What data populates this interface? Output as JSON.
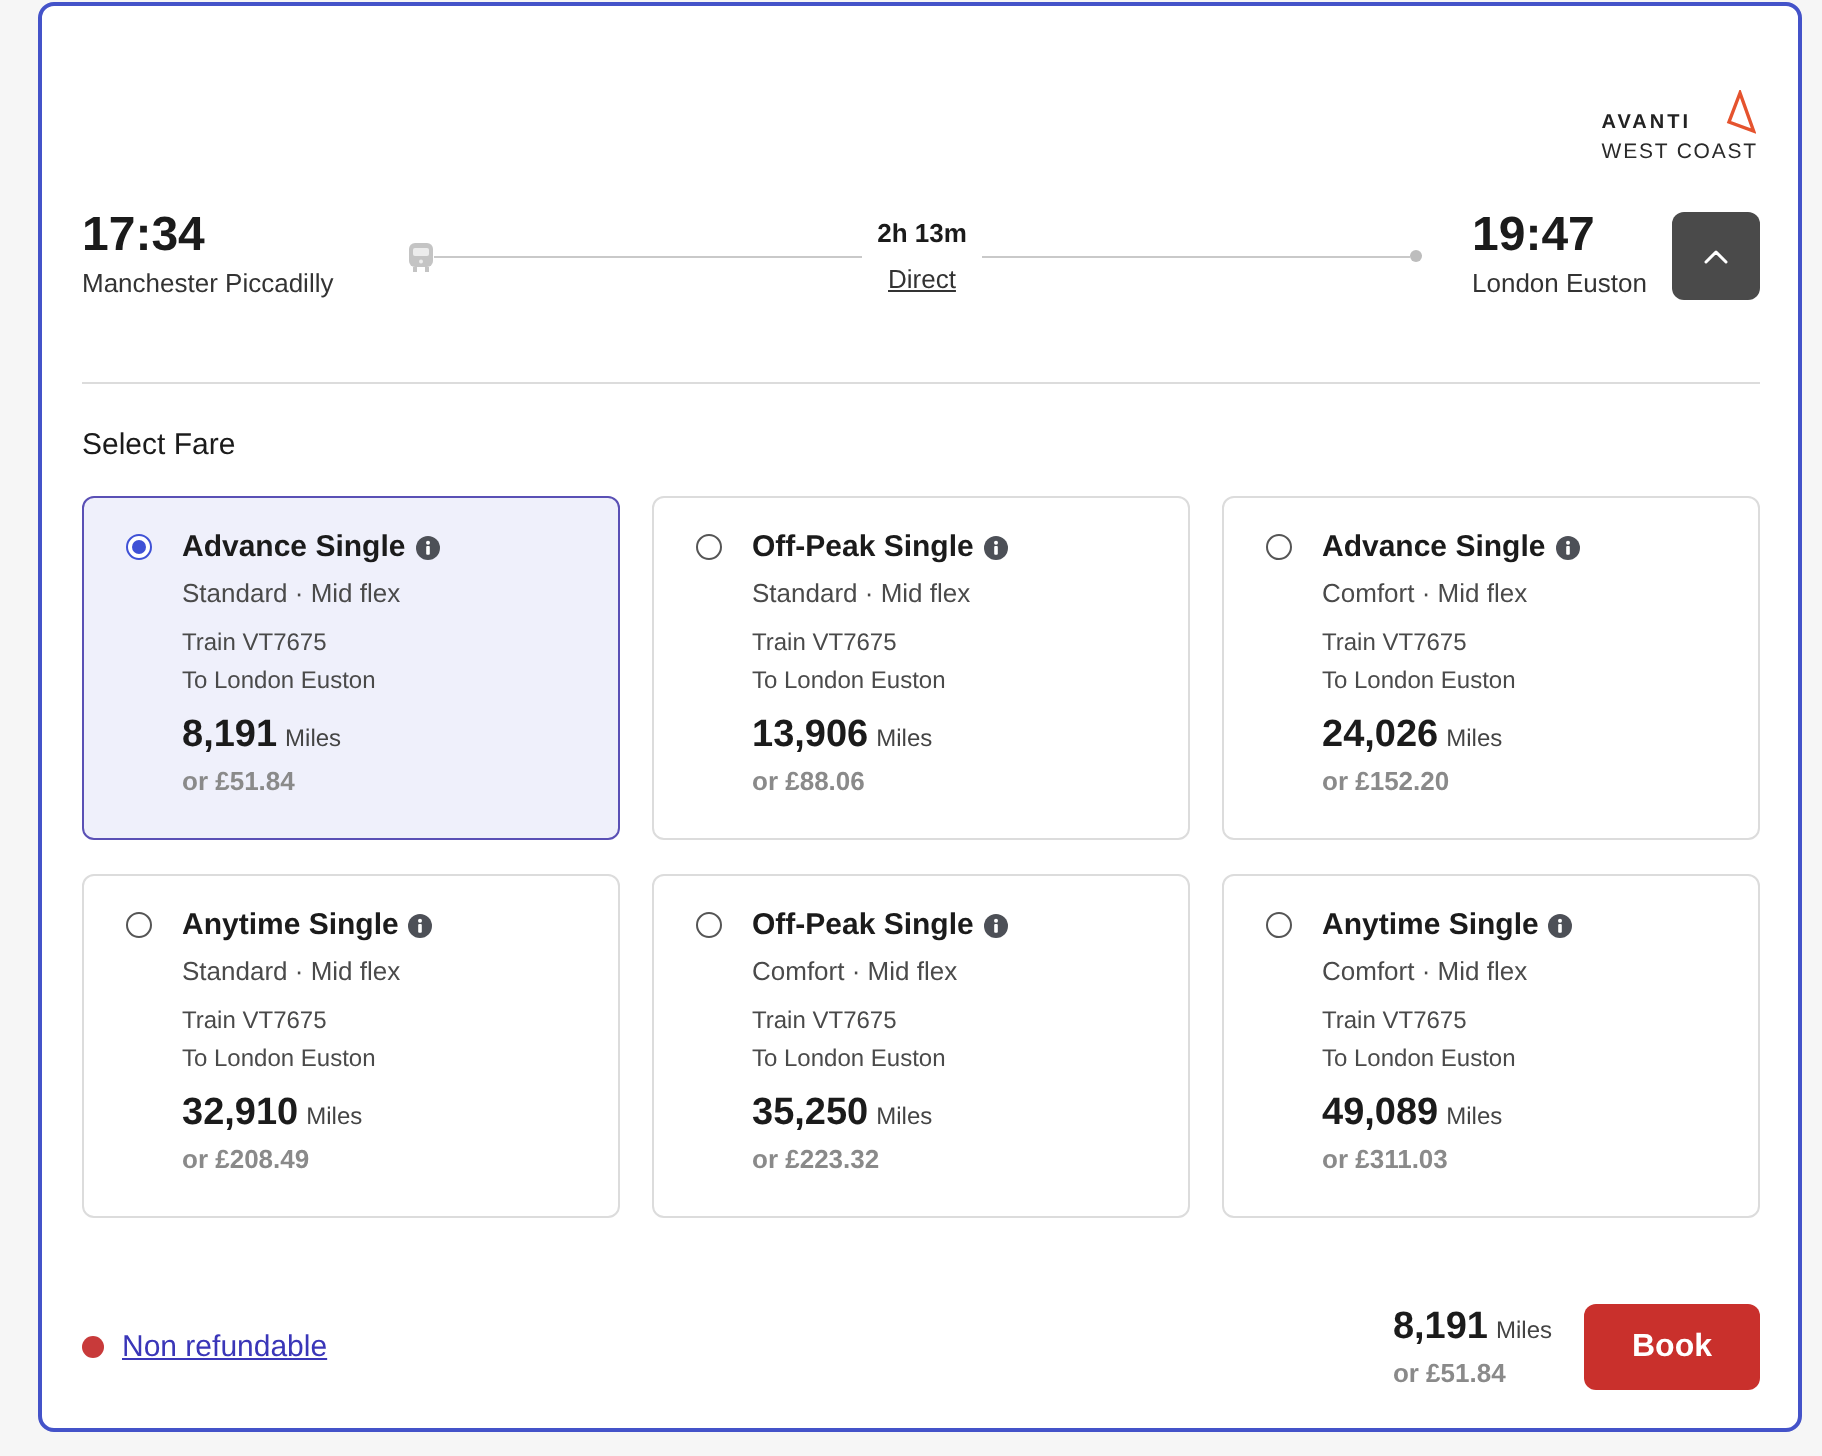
{
  "logo": {
    "name": "AVANTI",
    "tagline": "WEST COAST"
  },
  "journey": {
    "departure": {
      "time": "17:34",
      "station": "Manchester Piccadilly"
    },
    "duration": "2h 13m",
    "connection": "Direct",
    "arrival": {
      "time": "19:47",
      "station": "London Euston"
    },
    "expanded": true
  },
  "fare_section": {
    "title": "Select Fare",
    "fares": [
      {
        "name": "Advance Single",
        "details": "Standard · Mid flex",
        "train": "Train VT7675",
        "destination": "To London Euston",
        "miles": "8,191",
        "miles_unit": "Miles",
        "price": "or £51.84",
        "selected": true
      },
      {
        "name": "Off-Peak Single",
        "details": "Standard · Mid flex",
        "train": "Train VT7675",
        "destination": "To London Euston",
        "miles": "13,906",
        "miles_unit": "Miles",
        "price": "or £88.06",
        "selected": false
      },
      {
        "name": "Advance Single",
        "details": "Comfort · Mid flex",
        "train": "Train VT7675",
        "destination": "To London Euston",
        "miles": "24,026",
        "miles_unit": "Miles",
        "price": "or £152.20",
        "selected": false
      },
      {
        "name": "Anytime Single",
        "details": "Standard · Mid flex",
        "train": "Train VT7675",
        "destination": "To London Euston",
        "miles": "32,910",
        "miles_unit": "Miles",
        "price": "or £208.49",
        "selected": false
      },
      {
        "name": "Off-Peak Single",
        "details": "Comfort · Mid flex",
        "train": "Train VT7675",
        "destination": "To London Euston",
        "miles": "35,250",
        "miles_unit": "Miles",
        "price": "or £223.32",
        "selected": false
      },
      {
        "name": "Anytime Single",
        "details": "Comfort · Mid flex",
        "train": "Train VT7675",
        "destination": "To London Euston",
        "miles": "49,089",
        "miles_unit": "Miles",
        "price": "or £311.03",
        "selected": false
      }
    ]
  },
  "footer": {
    "refund": {
      "label": "Non refundable",
      "color": "#c83a3a"
    },
    "total": {
      "miles": "8,191",
      "miles_unit": "Miles",
      "price": "or £51.84"
    },
    "button": "Book"
  }
}
